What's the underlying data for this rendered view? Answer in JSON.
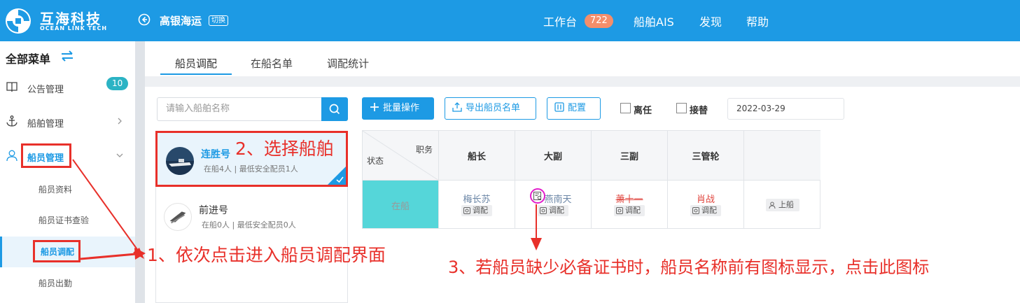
{
  "header": {
    "brand_name": "互海科技",
    "brand_sub": "OCEAN LINK TECH",
    "company": "高银海运",
    "switch_label": "切换",
    "nav": [
      {
        "label": "工作台"
      },
      {
        "label": "船舶AIS"
      },
      {
        "label": "发现"
      },
      {
        "label": "帮助"
      }
    ],
    "workbench_badge": "722"
  },
  "sidebar": {
    "title": "全部菜单",
    "items": [
      {
        "label": "公告管理",
        "icon": "book-icon"
      },
      {
        "label": "船舶管理",
        "icon": "anchor-icon"
      },
      {
        "label": "船员管理",
        "icon": "user-icon"
      }
    ],
    "notice_badge": "10",
    "sub_items": [
      {
        "label": "船员资料"
      },
      {
        "label": "船员证书查验"
      },
      {
        "label": "船员调配"
      },
      {
        "label": "船员出勤"
      }
    ]
  },
  "tabs": [
    {
      "label": "船员调配"
    },
    {
      "label": "在船名单"
    },
    {
      "label": "调配统计"
    }
  ],
  "ship_search": {
    "placeholder": "请输入船舶名称"
  },
  "ships": [
    {
      "name": "连胜号",
      "meta": "在船4人 | 最低安全配员1人"
    },
    {
      "name": "前进号",
      "meta": "在船0人 | 最低安全配员0人"
    }
  ],
  "toolbar": {
    "batch_label": "批量操作",
    "export_label": "导出船员名单",
    "config_label": "配置",
    "leave_label": "离任",
    "replace_label": "接替",
    "date": "2022-03-29"
  },
  "grid": {
    "corner_role": "职务",
    "corner_status": "状态",
    "columns": [
      "船长",
      "大副",
      "三副",
      "三管轮"
    ],
    "row_status": "在船",
    "crew": [
      {
        "name": "梅长苏",
        "color": "#6b86a6"
      },
      {
        "name": "燕南天",
        "color": "#6b86a6"
      },
      {
        "name": "萧十一",
        "color": "#e0463f"
      },
      {
        "name": "肖战",
        "color": "#e0463f"
      }
    ],
    "adjust_label": "调配",
    "board_label": "上船"
  },
  "annotations": {
    "step1": "1、依次点击进入船员调配界面",
    "step2": "2、选择船舶",
    "step3": "3、若船员缺少必备证书时，船员名称前有图标显示，点击此图标"
  },
  "colors": {
    "primary": "#1d9ae4",
    "annotation": "#e8302a",
    "status_cell": "#55d6d9",
    "highlight_ring": "#e21ecb"
  }
}
